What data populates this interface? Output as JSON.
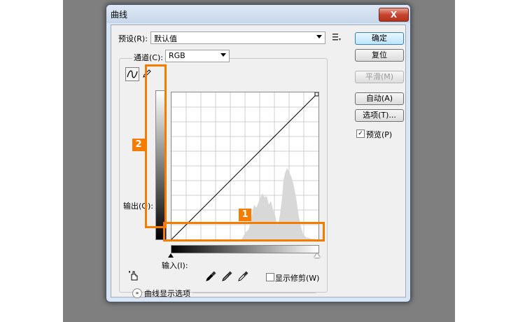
{
  "dialog": {
    "title": "曲线",
    "close_glyph": "X"
  },
  "preset": {
    "label": "预设(R):",
    "value": "默认值"
  },
  "channel": {
    "label": "通道(C):",
    "value": "RGB"
  },
  "buttons": {
    "ok": "确定",
    "reset": "复位",
    "smooth": "平滑(M)",
    "auto": "自动(A)",
    "options": "选项(T)..."
  },
  "preview": {
    "label": "预览(P)",
    "checked": true
  },
  "labels": {
    "output": "输出(O):",
    "input": "输入(I):",
    "show_clipping": "显示修剪(W)",
    "curve_display_options": "曲线显示选项"
  },
  "annotations": {
    "badge1": "1",
    "badge2": "2",
    "color": "#f57c00"
  },
  "icons": {
    "curve_tool": "curve-point-icon",
    "pencil_tool": "pencil-icon",
    "preset_menu": "preset-menu-icon",
    "hand_tool": "on-image-adjust-icon",
    "black_eyedropper": "black-eyedropper-icon",
    "gray_eyedropper": "gray-eyedropper-icon",
    "white_eyedropper": "white-eyedropper-icon",
    "expand": "expand-chevron-icon"
  }
}
